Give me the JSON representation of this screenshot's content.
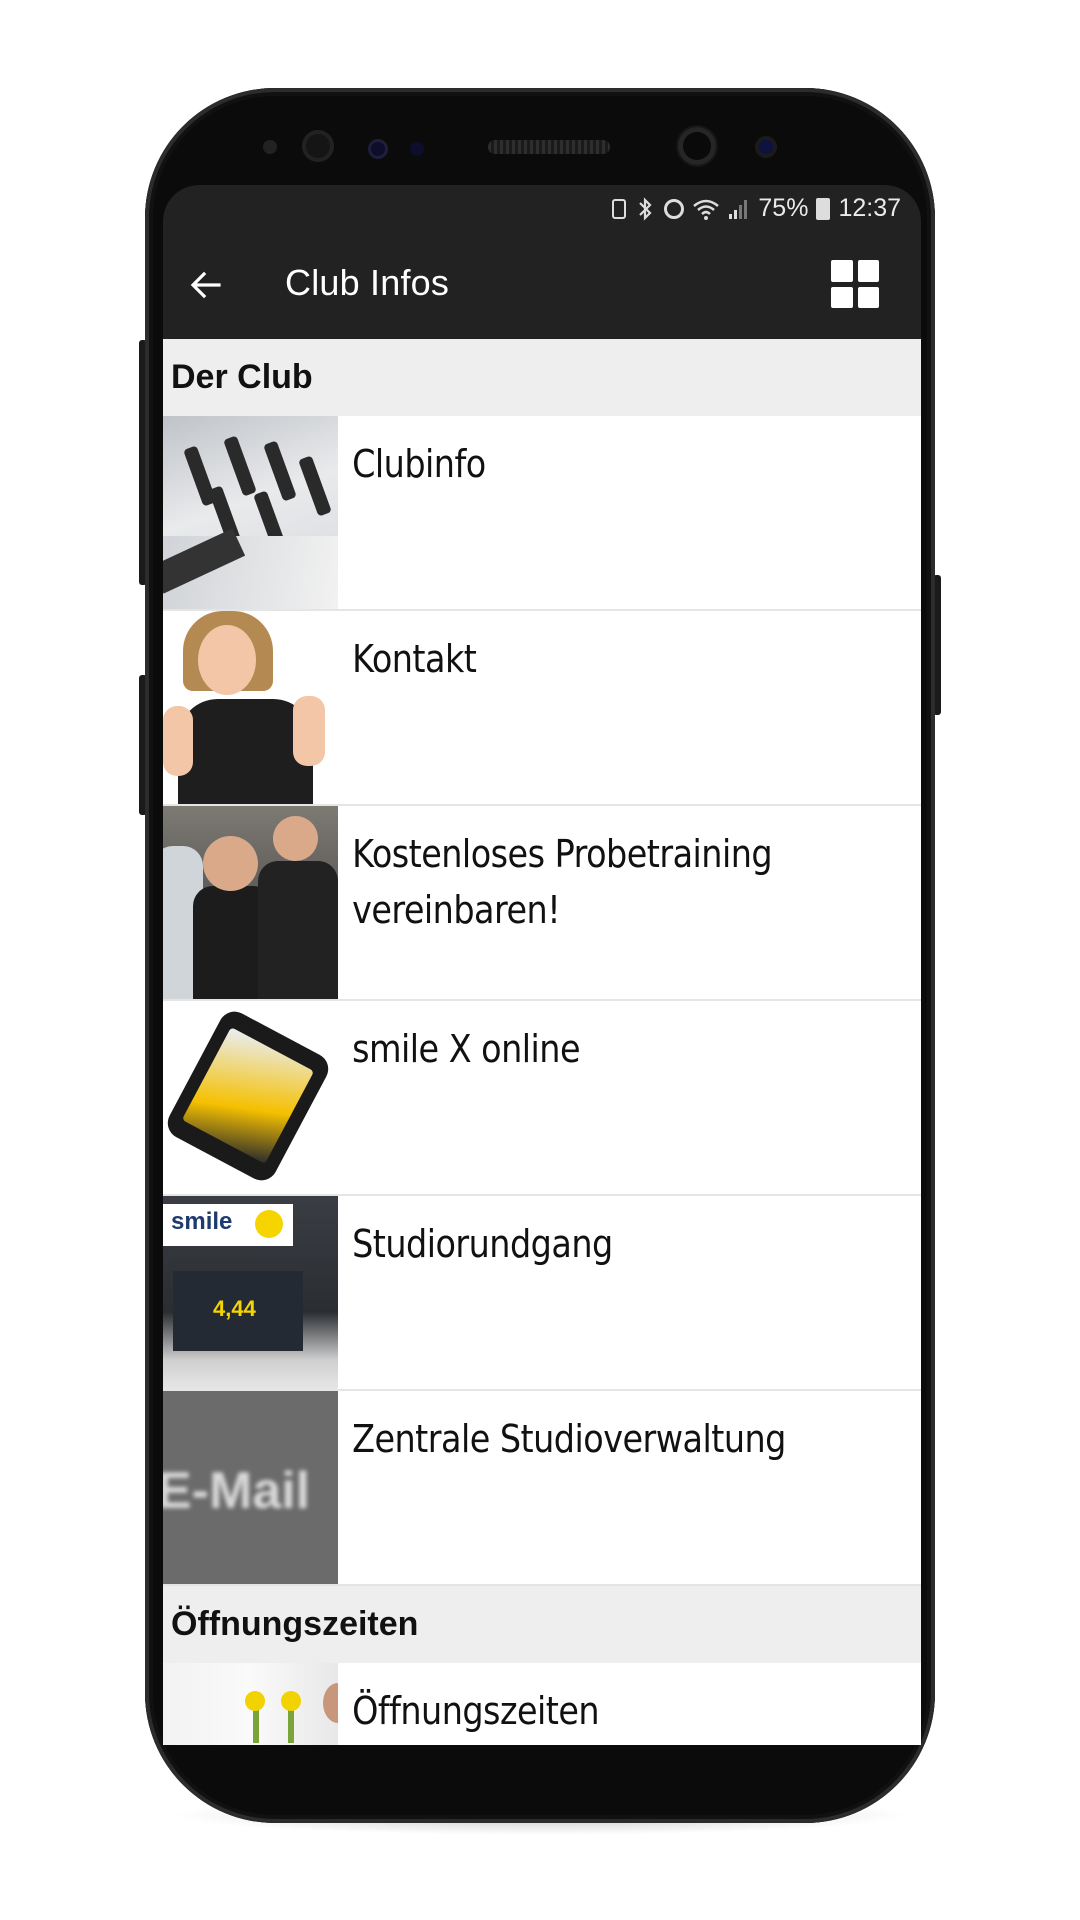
{
  "status_bar": {
    "battery_percent": "75%",
    "time": "12:37",
    "icons": [
      "battery-saver-icon",
      "bluetooth-icon",
      "alarm-icon",
      "wifi-icon",
      "signal-icon",
      "battery-icon"
    ]
  },
  "app_bar": {
    "back_icon": "arrow-left-icon",
    "title": "Club Infos",
    "view_toggle_icon": "grid-icon"
  },
  "sections": [
    {
      "header": "Der Club",
      "items": [
        {
          "label": "Clubinfo",
          "thumbnail": "gym-equipment"
        },
        {
          "label": "Kontakt",
          "thumbnail": "trainer-thumbs-up"
        },
        {
          "label": "Kostenloses Probetraining vereinbaren!",
          "thumbnail": "trainer-session"
        },
        {
          "label": "smile X online",
          "thumbnail": "smartphone-app"
        },
        {
          "label": "Studiorundgang",
          "thumbnail": "studio-exterior"
        },
        {
          "label": "Zentrale Studioverwaltung",
          "thumbnail": "e-mail"
        }
      ]
    },
    {
      "header": "Öffnungszeiten",
      "items": [
        {
          "label": "Öffnungszeiten",
          "thumbnail": "reception-flowers"
        }
      ]
    }
  ],
  "thumb_text": {
    "studio_logo": "smile",
    "studio_poster": "4,44",
    "mail": "E-Mail"
  },
  "colors": {
    "app_bar": "#222222",
    "section_header_bg": "#eeeeee",
    "list_bg": "#ffffff",
    "accent_yellow": "#f6d400"
  }
}
